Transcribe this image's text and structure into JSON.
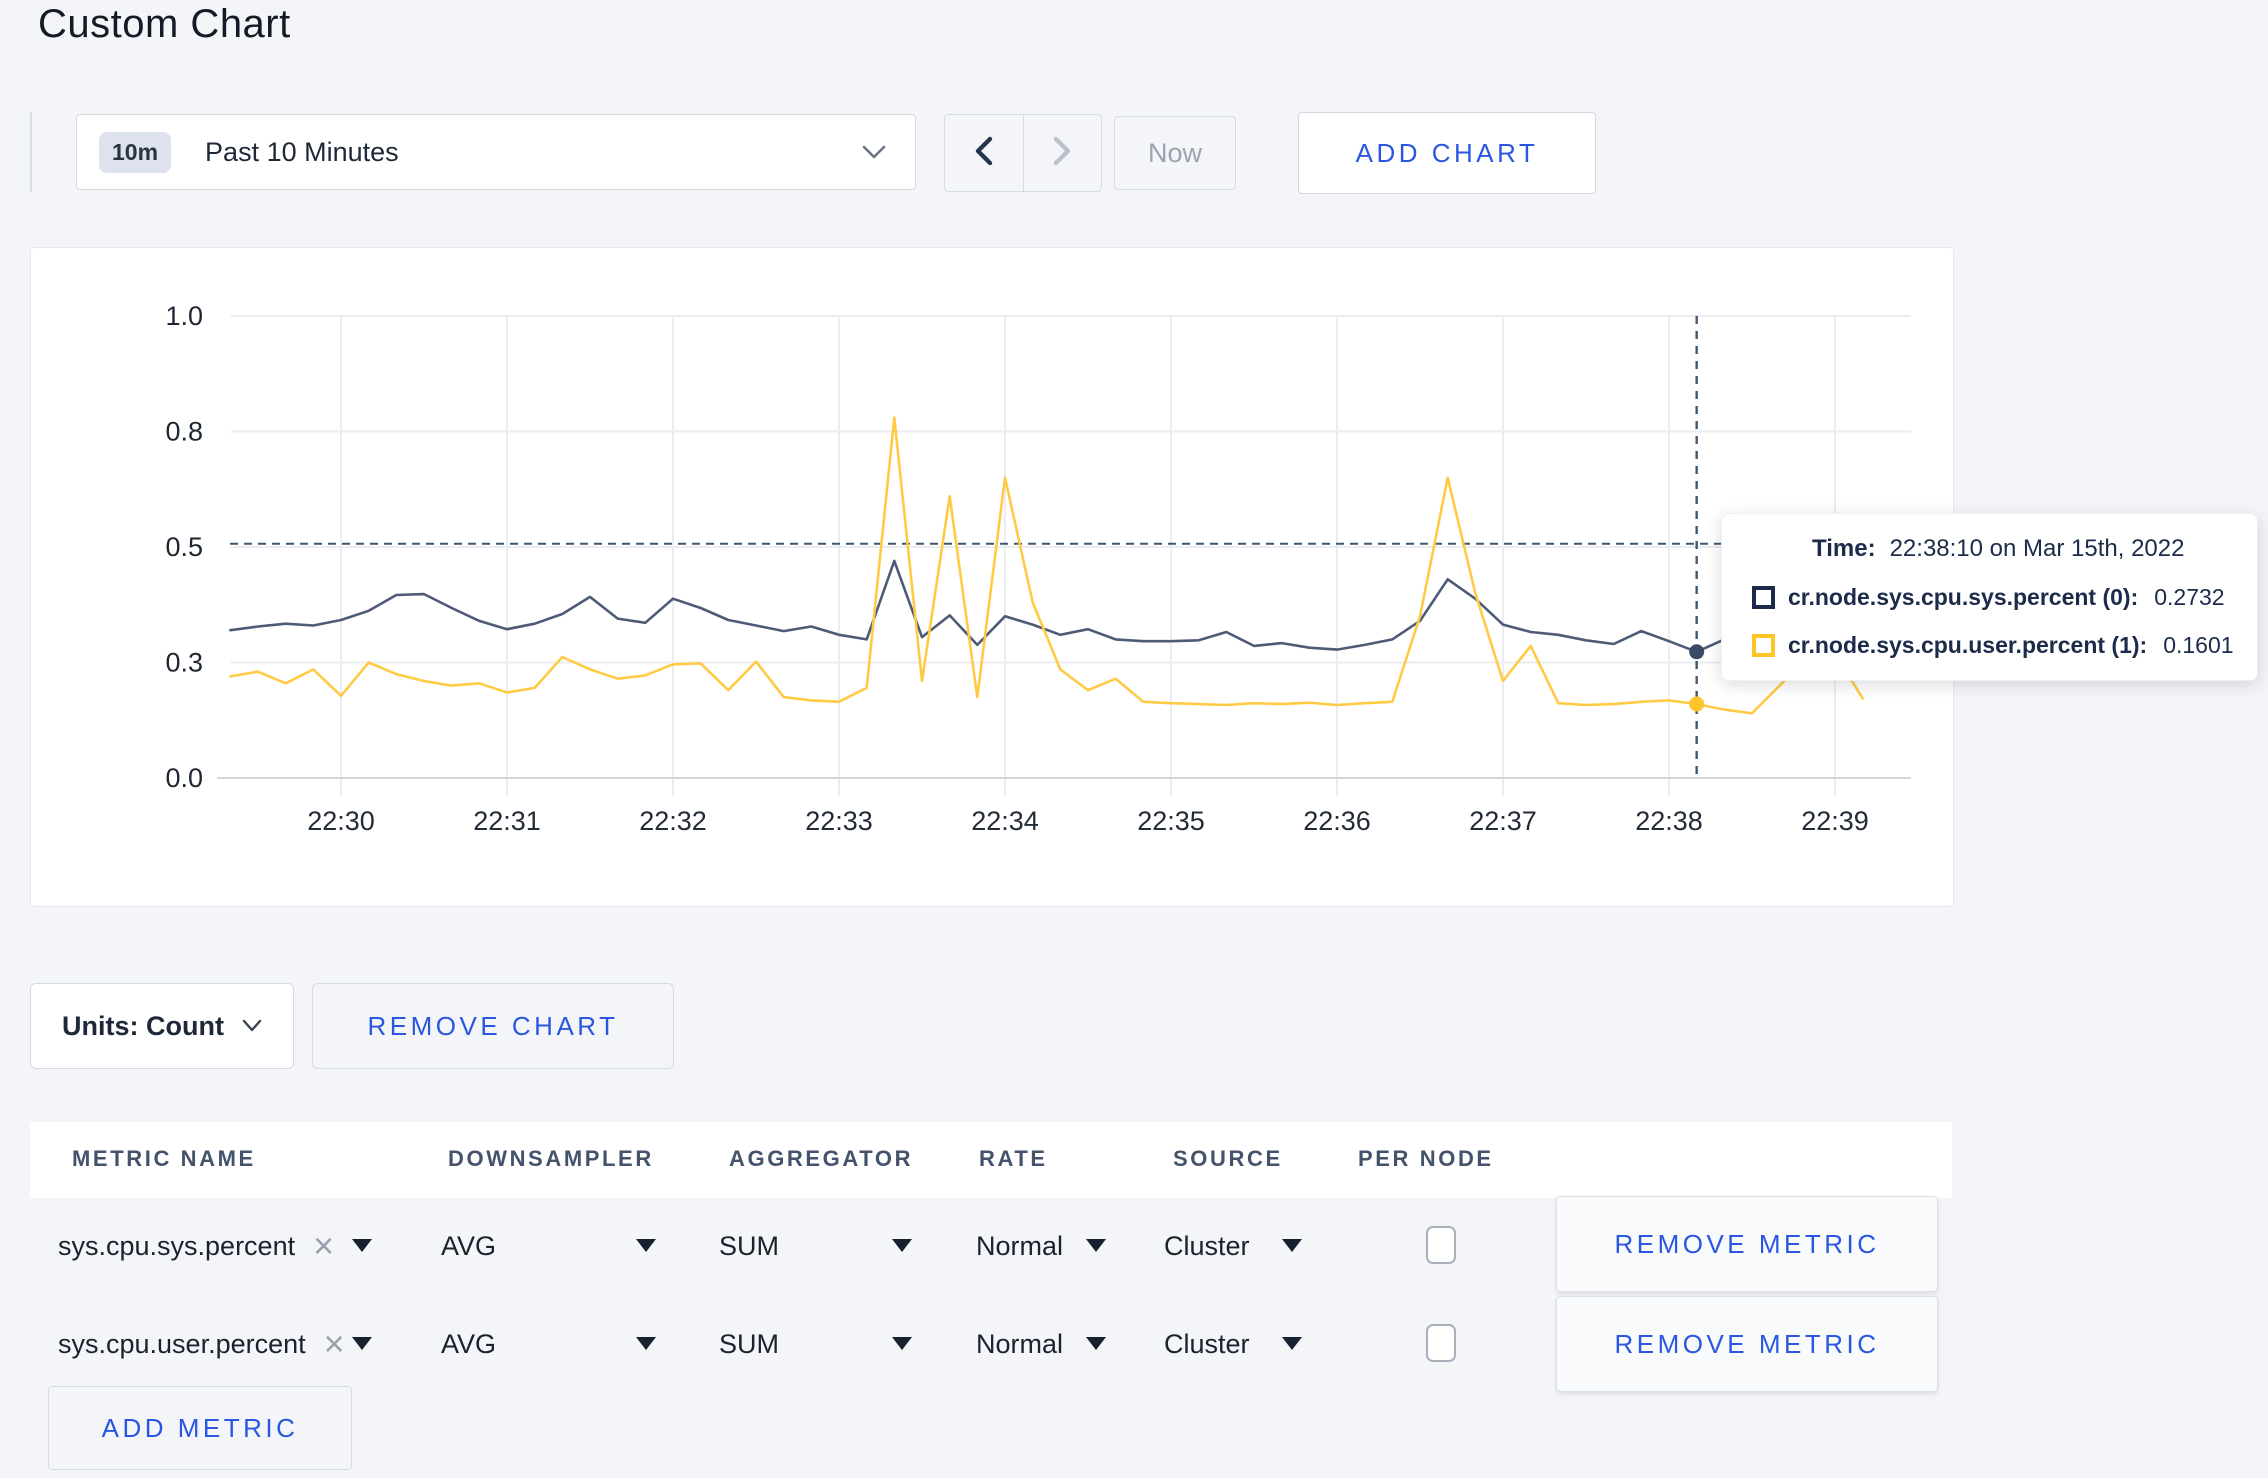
{
  "page": {
    "title": "Custom Chart"
  },
  "colors": {
    "action_blue": "#2B57E0",
    "series_sys": "#4E5B77",
    "series_user": "#FFCB45",
    "marker_sys": "#3A4A66",
    "marker_user": "#FFC52C",
    "crosshair": "#3E586F",
    "grid_light": "#ECEDF1",
    "grid_axis": "#D4D6DB"
  },
  "icons": {
    "dropdown_chevron": "chevron-down",
    "prev_arrow": "chevron-left",
    "next_arrow": "chevron-right",
    "remove_tag_glyph": "×",
    "select_caret": "triangle-down"
  },
  "toolbar": {
    "range_badge": "10m",
    "range_label": "Past 10 Minutes",
    "now_label": "Now",
    "add_chart_label": "ADD CHART"
  },
  "tooltip": {
    "time_label": "Time:",
    "time_value": "22:38:10 on Mar 15th, 2022",
    "rows": [
      {
        "label": "cr.node.sys.cpu.sys.percent (0):",
        "value": "0.2732",
        "color": "#1C2B49"
      },
      {
        "label": "cr.node.sys.cpu.user.percent (1):",
        "value": "0.1601",
        "color": "#FFC527"
      }
    ]
  },
  "units": {
    "label": "Units: Count",
    "remove_chart_label": "REMOVE CHART"
  },
  "metrics_table": {
    "columns": [
      "METRIC NAME",
      "DOWNSAMPLER",
      "AGGREGATOR",
      "RATE",
      "SOURCE",
      "PER NODE"
    ],
    "remove_metric_label": "REMOVE METRIC",
    "add_metric_label": "ADD METRIC",
    "rows": [
      {
        "name": "sys.cpu.sys.percent",
        "downsampler": "AVG",
        "aggregator": "SUM",
        "rate": "Normal",
        "source": "Cluster",
        "per_node_checked": false
      },
      {
        "name": "sys.cpu.user.percent",
        "downsampler": "AVG",
        "aggregator": "SUM",
        "rate": "Normal",
        "source": "Cluster",
        "per_node_checked": false
      }
    ]
  },
  "chart_data": {
    "type": "line",
    "title": "",
    "xlabel": "",
    "ylabel": "",
    "ylim": [
      0,
      1
    ],
    "grid": true,
    "legend_position": "tooltip",
    "xticks": [
      "22:30",
      "22:31",
      "22:32",
      "22:33",
      "22:34",
      "22:35",
      "22:36",
      "22:37",
      "22:38",
      "22:39"
    ],
    "yticks": [
      {
        "label": "0.0",
        "v": 0.0
      },
      {
        "label": "0.3",
        "v": 0.25
      },
      {
        "label": "0.5",
        "v": 0.5
      },
      {
        "label": "0.8",
        "v": 0.75
      },
      {
        "label": "1.0",
        "v": 1.0
      }
    ],
    "interval_seconds": 10,
    "times": [
      "22:29:20",
      "22:29:30",
      "22:29:40",
      "22:29:50",
      "22:30:00",
      "22:30:10",
      "22:30:20",
      "22:30:30",
      "22:30:40",
      "22:30:50",
      "22:31:00",
      "22:31:10",
      "22:31:20",
      "22:31:30",
      "22:31:40",
      "22:31:50",
      "22:32:00",
      "22:32:10",
      "22:32:20",
      "22:32:30",
      "22:32:40",
      "22:32:50",
      "22:33:00",
      "22:33:10",
      "22:33:20",
      "22:33:30",
      "22:33:40",
      "22:33:50",
      "22:34:00",
      "22:34:10",
      "22:34:20",
      "22:34:30",
      "22:34:40",
      "22:34:50",
      "22:35:00",
      "22:35:10",
      "22:35:20",
      "22:35:30",
      "22:35:40",
      "22:35:50",
      "22:36:00",
      "22:36:10",
      "22:36:20",
      "22:36:30",
      "22:36:40",
      "22:36:50",
      "22:37:00",
      "22:37:10",
      "22:37:20",
      "22:37:30",
      "22:37:40",
      "22:37:50",
      "22:38:00",
      "22:38:10",
      "22:38:20",
      "22:38:30",
      "22:38:40",
      "22:38:50",
      "22:39:00",
      "22:39:10"
    ],
    "series": [
      {
        "name": "cr.node.sys.cpu.sys.percent (0)",
        "color": "#4E5B77",
        "values": [
          0.32,
          0.328,
          0.334,
          0.33,
          0.342,
          0.362,
          0.396,
          0.398,
          0.368,
          0.34,
          0.322,
          0.334,
          0.355,
          0.392,
          0.345,
          0.336,
          0.388,
          0.368,
          0.342,
          0.33,
          0.318,
          0.328,
          0.31,
          0.3,
          0.47,
          0.305,
          0.352,
          0.288,
          0.35,
          0.332,
          0.31,
          0.322,
          0.3,
          0.296,
          0.296,
          0.298,
          0.316,
          0.286,
          0.292,
          0.282,
          0.278,
          0.288,
          0.3,
          0.34,
          0.43,
          0.388,
          0.332,
          0.316,
          0.31,
          0.298,
          0.29,
          0.318,
          0.296,
          0.2732,
          0.3,
          0.296,
          0.294,
          0.298,
          0.3,
          0.304
        ]
      },
      {
        "name": "cr.node.sys.cpu.user.percent (1)",
        "color": "#FFCB45",
        "values": [
          0.22,
          0.23,
          0.205,
          0.235,
          0.178,
          0.25,
          0.225,
          0.21,
          0.2,
          0.205,
          0.185,
          0.195,
          0.262,
          0.235,
          0.215,
          0.222,
          0.246,
          0.248,
          0.19,
          0.252,
          0.175,
          0.168,
          0.165,
          0.195,
          0.78,
          0.21,
          0.61,
          0.175,
          0.65,
          0.38,
          0.235,
          0.19,
          0.215,
          0.165,
          0.162,
          0.16,
          0.158,
          0.162,
          0.16,
          0.163,
          0.158,
          0.162,
          0.165,
          0.35,
          0.65,
          0.4,
          0.21,
          0.286,
          0.162,
          0.158,
          0.16,
          0.165,
          0.168,
          0.1601,
          0.148,
          0.14,
          0.2,
          0.262,
          0.27,
          0.172
        ]
      }
    ],
    "crosshair": {
      "index": 53,
      "time": "22:38:10",
      "guide_value": 0.507,
      "sys_value": 0.2732,
      "user_value": 0.1601
    }
  }
}
